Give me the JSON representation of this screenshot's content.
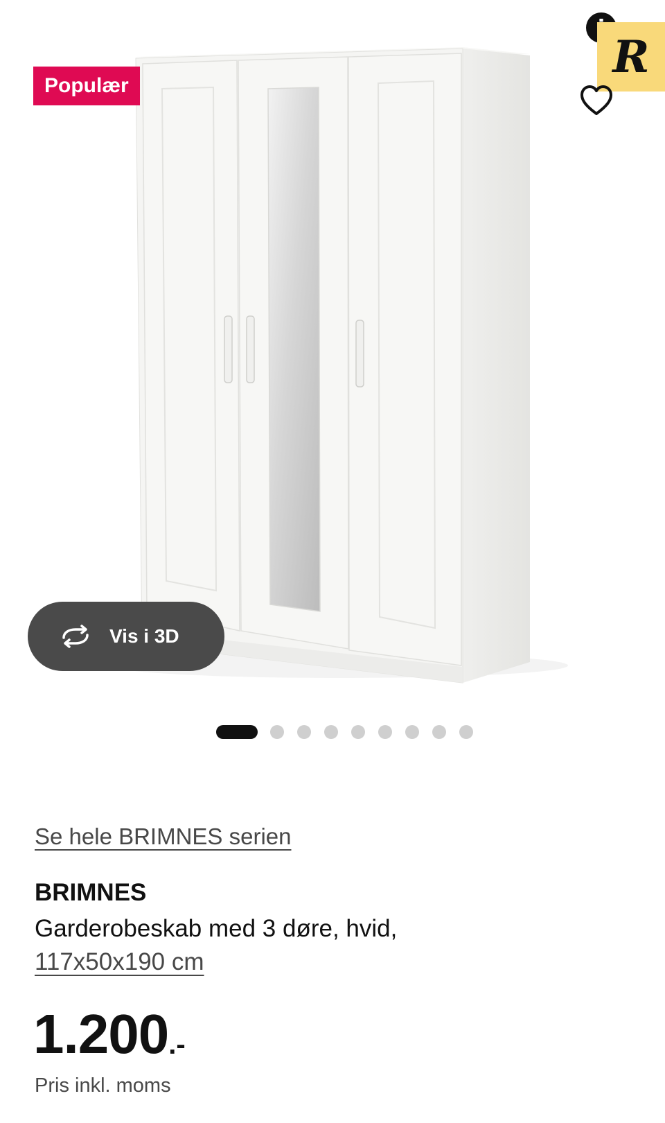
{
  "gallery": {
    "badge_label": "Populær",
    "view3d_label": "Vis i 3D",
    "slide_count": 9,
    "active_slide": 1
  },
  "product": {
    "series_link": "Se hele BRIMNES serien",
    "name": "BRIMNES",
    "description": "Garderobeskab med 3 døre, hvid,",
    "size": "117x50x190 cm",
    "price": "1.200",
    "price_suffix": ".-",
    "vat_note": "Pris inkl. moms"
  },
  "overlay": {
    "info_label": "i",
    "logo_letter": "R"
  },
  "icons": [
    "heart-icon",
    "rotate-3d-icon",
    "info-icon",
    "ad-logo"
  ],
  "colors": {
    "badge": "#DF0A53",
    "view3d_button": "#4A4A4A",
    "dot_active": "#111111",
    "dot_inactive": "#CFCFCF",
    "logo_background": "#F9D97A",
    "text_primary": "#111111",
    "text_secondary": "#484848"
  }
}
